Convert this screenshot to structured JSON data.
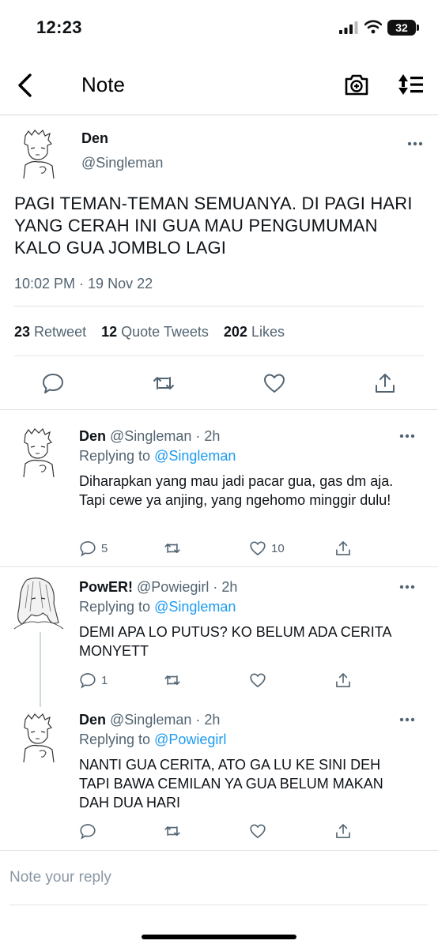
{
  "status_bar": {
    "time": "12:23",
    "battery": "32"
  },
  "nav": {
    "title": "Note"
  },
  "main_tweet": {
    "name": "Den",
    "handle": "@Singleman",
    "text": "PAGI TEMAN-TEMAN SEMUANYA. DI PAGI HARI YANG CERAH INI GUA MAU PENGUMUMAN KALO GUA JOMBLO LAGI",
    "timestamp": "10:02 PM · 19 Nov 22",
    "stats": {
      "retweets": "23",
      "retweets_label": "Retweet",
      "quotes": "12",
      "quotes_label": "Quote Tweets",
      "likes": "202",
      "likes_label": "Likes"
    }
  },
  "replies": [
    {
      "name": "Den",
      "handle": "@Singleman",
      "time": "· 2h",
      "replying_label": "Replying to",
      "replying_to": "@Singleman",
      "text": "Diharapkan yang mau jadi pacar gua, gas dm aja. Tapi cewe ya anjing, yang ngehomo minggir dulu!",
      "reply_count": "5",
      "like_count": "10"
    },
    {
      "name": "PowER!",
      "handle": "@Powiegirl",
      "time": "· 2h",
      "replying_label": "Replying to",
      "replying_to": "@Singleman",
      "text": "DEMI APA LO PUTUS? KO BELUM ADA CERITA MONYETT",
      "reply_count": "1",
      "like_count": ""
    },
    {
      "name": "Den",
      "handle": "@Singleman",
      "time": "· 2h",
      "replying_label": "Replying to",
      "replying_to": "@Powiegirl",
      "text": "NANTI GUA CERITA, ATO GA LU KE SINI DEH TAPI BAWA CEMILAN YA GUA BELUM MAKAN DAH DUA HARI",
      "reply_count": "",
      "like_count": ""
    }
  ],
  "reply_box": {
    "placeholder": "Note your reply"
  },
  "icons": {
    "back": "chevron-left-icon",
    "camera": "camera-plus-icon",
    "sort": "sort-arrows-icon",
    "reply": "comment-icon",
    "retweet": "retweet-icon",
    "like": "heart-icon",
    "share": "share-icon",
    "more": "more-dots-icon"
  },
  "colors": {
    "link": "#1d9bf0",
    "secondary": "#536471",
    "text": "#0f1419"
  }
}
